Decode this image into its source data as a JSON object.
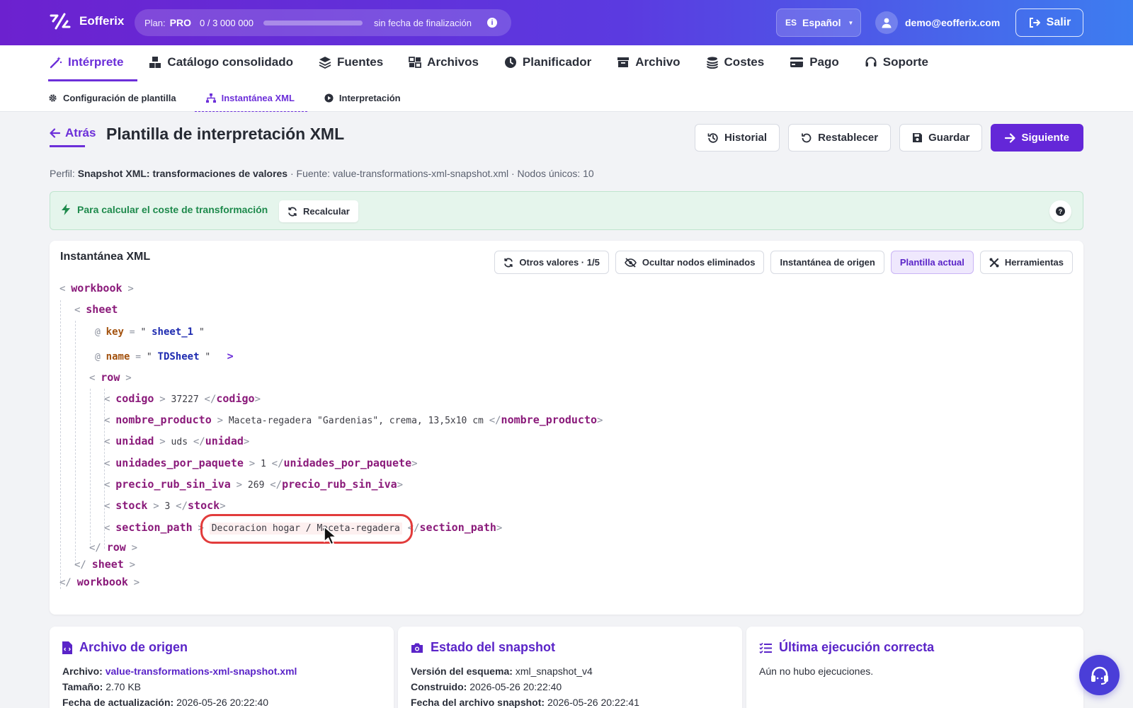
{
  "app": {
    "name": "Eofferix"
  },
  "plan": {
    "label": "Plan:",
    "tier": "PRO",
    "used": "0",
    "separator": "/",
    "limit": "3 000 000",
    "usage_fraction": 0,
    "expiry": "sin fecha de finalización",
    "info_glyph": "i"
  },
  "language": {
    "code": "ES",
    "name": "Español"
  },
  "user": {
    "email": "demo@eofferix.com"
  },
  "logout_label": "Salir",
  "main_nav": [
    {
      "label": "Intérprete",
      "icon": "magic-wand-icon",
      "active": true
    },
    {
      "label": "Catálogo consolidado",
      "icon": "boxes-icon",
      "active": false
    },
    {
      "label": "Fuentes",
      "icon": "layers-icon",
      "active": false
    },
    {
      "label": "Archivos",
      "icon": "files-icon",
      "active": false
    },
    {
      "label": "Planificador",
      "icon": "clock-icon",
      "active": false
    },
    {
      "label": "Archivo",
      "icon": "archive-box-icon",
      "active": false
    },
    {
      "label": "Costes",
      "icon": "coins-icon",
      "active": false
    },
    {
      "label": "Pago",
      "icon": "credit-card-icon",
      "active": false
    },
    {
      "label": "Soporte",
      "icon": "headset-icon",
      "active": false
    }
  ],
  "sub_nav": [
    {
      "label": "Configuración de plantilla",
      "icon": "gear-icon",
      "active": false
    },
    {
      "label": "Instantánea XML",
      "icon": "sitemap-icon",
      "active": true
    },
    {
      "label": "Interpretación",
      "icon": "play-circle-icon",
      "active": false
    }
  ],
  "page": {
    "back_label": "Atrás",
    "title": "Plantilla de interpretación XML",
    "actions": {
      "history": "Historial",
      "reset": "Restablecer",
      "save": "Guardar",
      "next": "Siguiente"
    },
    "profile": {
      "profile_label": "Perfil:",
      "profile_name": "Snapshot XML: transformaciones de valores",
      "source": "· Fuente: value-transformations-xml-snapshot.xml · Nodos únicos: 10"
    }
  },
  "alert": {
    "text": "Para calcular el coste de transformación",
    "button": "Recalcular",
    "help_glyph": "?"
  },
  "snapshot": {
    "title": "Instantánea XML",
    "tools": {
      "other_values": "Otros valores · 1/5",
      "hide_removed": "Ocultar nodos eliminados",
      "source_snapshot": "Instantánea de origen",
      "current_template": "Plantilla actual",
      "tools": "Herramientas"
    },
    "glyphs": {
      "lt": "<",
      "gt": ">",
      "close_lt": "</",
      "at": "@",
      "eq": "=",
      "quote": "\""
    },
    "xml": {
      "workbook": "workbook",
      "sheet": "sheet",
      "attrs": [
        {
          "name": "key",
          "value": "sheet_1"
        },
        {
          "name": "name",
          "value": "TDSheet"
        }
      ],
      "row": "row",
      "fields": [
        {
          "tag": "codigo",
          "value": "37227"
        },
        {
          "tag": "nombre_producto",
          "value": "Maceta-regadera \"Gardenias\", crema, 13,5x10 cm"
        },
        {
          "tag": "unidad",
          "value": "uds"
        },
        {
          "tag": "unidades_por_paquete",
          "value": "1"
        },
        {
          "tag": "precio_rub_sin_iva",
          "value": "269"
        },
        {
          "tag": "stock",
          "value": "3"
        },
        {
          "tag": "section_path",
          "value": "Decoracion hogar / Maceta-regadera"
        }
      ]
    }
  },
  "source_file": {
    "title": "Archivo de origen",
    "file_label": "Archivo:",
    "file": "value-transformations-xml-snapshot.xml",
    "size_label": "Tamaño:",
    "size": "2.70 KB",
    "updated_label": "Fecha de actualización:",
    "updated": "2026-05-26 20:22:40"
  },
  "snapshot_state": {
    "title": "Estado del snapshot",
    "schema_label": "Versión del esquema:",
    "schema": "xml_snapshot_v4",
    "built_label": "Construido:",
    "built": "2026-05-26 20:22:40",
    "file_date_label": "Fecha del archivo snapshot:",
    "file_date": "2026-05-26 20:22:41"
  },
  "last_run": {
    "title": "Última ejecución correcta",
    "text": "Aún no hubo ejecuciones."
  },
  "colors": {
    "accent": "#6427d8",
    "success_bg": "#e5f5ec",
    "success_text": "#1e8a4c",
    "highlight": "#e23c3c",
    "xml_tag": "#8a1a7a"
  }
}
